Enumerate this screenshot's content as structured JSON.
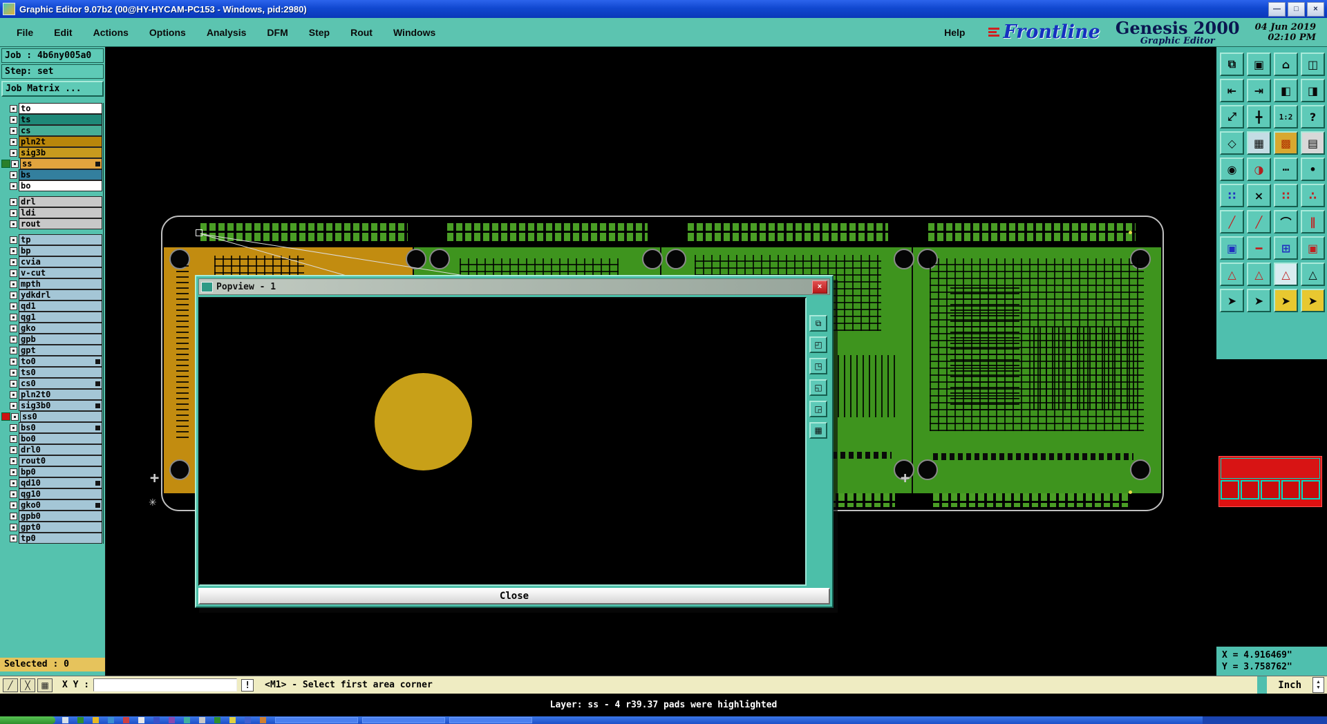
{
  "window": {
    "title": "Graphic Editor 9.07b2 (00@HY-HYCAM-PC153 - Windows, pid:2980)",
    "controls": [
      {
        "name": "minimize",
        "glyph": "—"
      },
      {
        "name": "maximize",
        "glyph": "□"
      },
      {
        "name": "close",
        "glyph": "×"
      }
    ]
  },
  "menu": {
    "items": [
      "File",
      "Edit",
      "Actions",
      "Options",
      "Analysis",
      "DFM",
      "Step",
      "Rout",
      "Windows"
    ],
    "help": "Help"
  },
  "branding": {
    "logo_text": "Frontline",
    "product": "Genesis 2000",
    "subtitle": "Graphic Editor",
    "date": "04 Jun 2019",
    "time": "02:10 PM"
  },
  "job_panel": {
    "job": "Job : 4b6ny005a0",
    "step": "Step: set",
    "matrix_button": "Job Matrix ..."
  },
  "layer_panel": {
    "groups": [
      [
        {
          "name": "to",
          "bg": "#ffffff"
        },
        {
          "name": "ts",
          "bg": "#1f8878"
        },
        {
          "name": "cs",
          "bg": "#46ae97"
        },
        {
          "name": "pln2t",
          "bg": "#b8860b"
        },
        {
          "name": "sig3b",
          "bg": "#c79a1e"
        },
        {
          "name": "ss",
          "bg": "#e2a43e",
          "left": "#2a7f2a",
          "right": true
        },
        {
          "name": "bs",
          "bg": "#337f9e"
        },
        {
          "name": "bo",
          "bg": "#ffffff"
        }
      ],
      [
        {
          "name": "drl",
          "bg": "#c8c8c8"
        },
        {
          "name": "ldi",
          "bg": "#c8c8c8"
        },
        {
          "name": "rout",
          "bg": "#c8c8c8"
        }
      ],
      [
        {
          "name": "tp",
          "bg": "#a4c6d6"
        },
        {
          "name": "bp",
          "bg": "#a4c6d6"
        },
        {
          "name": "cvia",
          "bg": "#a4c6d6"
        },
        {
          "name": "v-cut",
          "bg": "#a4c6d6"
        },
        {
          "name": "mpth",
          "bg": "#a4c6d6"
        },
        {
          "name": "ydkdrl",
          "bg": "#a4c6d6"
        },
        {
          "name": "qd1",
          "bg": "#a4c6d6"
        },
        {
          "name": "qg1",
          "bg": "#a4c6d6"
        },
        {
          "name": "gko",
          "bg": "#a4c6d6"
        },
        {
          "name": "gpb",
          "bg": "#a4c6d6"
        },
        {
          "name": "gpt",
          "bg": "#a4c6d6"
        },
        {
          "name": "to0",
          "bg": "#a4c6d6",
          "right": true
        },
        {
          "name": "ts0",
          "bg": "#a4c6d6"
        },
        {
          "name": "cs0",
          "bg": "#a4c6d6",
          "right": true
        },
        {
          "name": "pln2t0",
          "bg": "#a4c6d6"
        },
        {
          "name": "sig3b0",
          "bg": "#a4c6d6",
          "right": true
        },
        {
          "name": "ss0",
          "bg": "#a4c6d6",
          "left": "#cc1111"
        },
        {
          "name": "bs0",
          "bg": "#a4c6d6",
          "right": true
        },
        {
          "name": "bo0",
          "bg": "#a4c6d6"
        },
        {
          "name": "drl0",
          "bg": "#a4c6d6"
        },
        {
          "name": "rout0",
          "bg": "#a4c6d6"
        },
        {
          "name": "bp0",
          "bg": "#a4c6d6"
        },
        {
          "name": "qd10",
          "bg": "#a4c6d6",
          "right": true
        },
        {
          "name": "qg10",
          "bg": "#a4c6d6"
        },
        {
          "name": "gko0",
          "bg": "#a4c6d6",
          "right": true
        },
        {
          "name": "gpb0",
          "bg": "#a4c6d6"
        },
        {
          "name": "gpt0",
          "bg": "#a4c6d6"
        },
        {
          "name": "tp0",
          "bg": "#a4c6d6"
        }
      ]
    ]
  },
  "selected_label": "Selected : 0",
  "toolbar": {
    "rows": [
      [
        {
          "n": "new-window",
          "g": "⧉"
        },
        {
          "n": "screen",
          "g": "▣"
        },
        {
          "n": "zoom-home",
          "g": "⌂"
        },
        {
          "n": "tile-windows",
          "g": "◫"
        }
      ],
      [
        {
          "n": "pan-west",
          "g": "⇤"
        },
        {
          "n": "pan-east",
          "g": "⇥"
        },
        {
          "n": "view-left",
          "g": "◧"
        },
        {
          "n": "view-right",
          "g": "◨"
        }
      ],
      [
        {
          "n": "zoom-fit",
          "g": "⤢"
        },
        {
          "n": "pan-center",
          "g": "╋"
        },
        {
          "n": "zoom-1-2",
          "g": "1:2"
        },
        {
          "n": "query",
          "g": "?"
        }
      ],
      [
        {
          "n": "measure",
          "g": "◇"
        },
        {
          "n": "grid-toggle",
          "g": "▦",
          "bg": "#c4dce4"
        },
        {
          "n": "highlight-grid",
          "g": "▩",
          "c": "#b03000",
          "bg": "#d8a830"
        },
        {
          "n": "layer-stripes",
          "g": "▤",
          "bg": "#d8d8d8"
        }
      ],
      [
        {
          "n": "pad-round",
          "g": "◉"
        },
        {
          "n": "pad-thermal",
          "g": "◑",
          "c": "#b02020"
        },
        {
          "n": "pad-line",
          "g": "┅"
        },
        {
          "n": "pad-dot",
          "g": "•"
        }
      ],
      [
        {
          "n": "cluster-blue",
          "g": "∷",
          "c": "#2030c0"
        },
        {
          "n": "delete-x",
          "g": "×"
        },
        {
          "n": "cluster-red",
          "g": "∷",
          "c": "#c02020"
        },
        {
          "n": "cluster-mixed",
          "g": "∴",
          "c": "#c02020"
        }
      ],
      [
        {
          "n": "line-red",
          "g": "╱",
          "c": "#c02020"
        },
        {
          "n": "line-red-2",
          "g": "╱",
          "c": "#c02020"
        },
        {
          "n": "arc-tool",
          "g": "⌒"
        },
        {
          "n": "vlines-red",
          "g": "∥",
          "c": "#c02020"
        }
      ],
      [
        {
          "n": "frame-blue",
          "g": "▣",
          "c": "#2030c0"
        },
        {
          "n": "minus-red",
          "g": "━",
          "c": "#c02020"
        },
        {
          "n": "pattern-plus",
          "g": "⊞",
          "c": "#2030c0"
        },
        {
          "n": "frame-red",
          "g": "▣",
          "c": "#c02020"
        }
      ],
      [
        {
          "n": "tri-red-1",
          "g": "△",
          "c": "#c02020"
        },
        {
          "n": "tri-red-2",
          "g": "△",
          "c": "#c02020"
        },
        {
          "n": "tri-light",
          "g": "△",
          "c": "#c02020",
          "bg": "#d8ecf0"
        },
        {
          "n": "tri-dark",
          "g": "△"
        }
      ],
      [
        {
          "n": "cursor-1",
          "g": "➤"
        },
        {
          "n": "cursor-2",
          "g": "➤"
        },
        {
          "n": "cursor-3",
          "g": "➤",
          "bg": "#e8c830"
        },
        {
          "n": "cursor-4",
          "g": "➤",
          "bg": "#e8c830"
        }
      ]
    ]
  },
  "coords": {
    "x": "X = 4.916469\"",
    "y": "Y = 3.758762\""
  },
  "command_bar": {
    "tool_icons": [
      {
        "name": "sketch-icon",
        "glyph": "╱"
      },
      {
        "name": "snap-icon",
        "glyph": "╳"
      },
      {
        "name": "grid-icon",
        "glyph": "▦"
      }
    ],
    "xy_label": "X Y :",
    "input_value": "",
    "alert_glyph": "!",
    "prompt": "<M1> - Select first area corner",
    "units": "Inch"
  },
  "status_bar": "Layer: ss - 4 r39.37 pads were highlighted",
  "popview": {
    "title": "Popview - 1",
    "close_glyph": "×",
    "side_tools": [
      {
        "name": "copy-view",
        "glyph": "⧉"
      },
      {
        "name": "pan-tl",
        "glyph": "◰"
      },
      {
        "name": "pan-tr",
        "glyph": "◳"
      },
      {
        "name": "pan-bl",
        "glyph": "◱"
      },
      {
        "name": "pan-br",
        "glyph": "◲"
      },
      {
        "name": "grid",
        "glyph": "▦"
      }
    ],
    "close_button": "Close",
    "circle_color": "#c8a018"
  },
  "taskbar": {
    "icon_colors": [
      "#d8e0e8",
      "#2e8f2c",
      "#e8b820",
      "#3a8fd0",
      "#d04040",
      "#e8e8e8",
      "#3a50c8",
      "#8a48b0",
      "#40b0a0",
      "#c8c8c8",
      "#2e8f2c",
      "#e0d040",
      "#4060d0",
      "#d08030"
    ]
  },
  "colors": {
    "pcb_green": "#3e941e",
    "pcb_orange": "#c28c10",
    "panel_teal": "#55c2ae",
    "map_red": "#dd1111"
  }
}
